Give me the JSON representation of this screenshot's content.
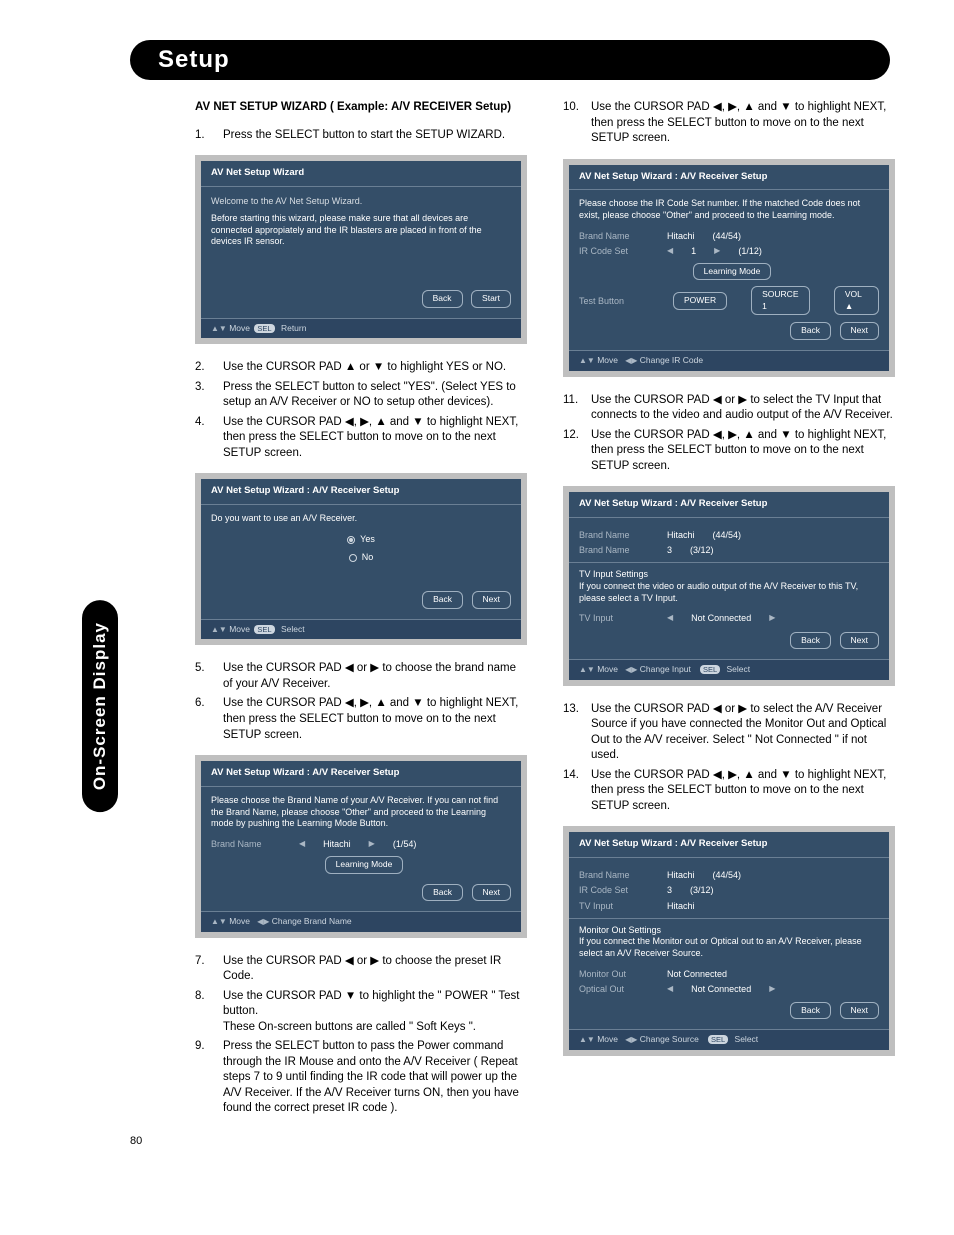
{
  "side_tab": "On-Screen Display",
  "header": {
    "title": "Setup"
  },
  "section_heading": "AV NET SETUP WIZARD ( Example: A/V RECEIVER Setup)",
  "page_number": "80",
  "left_steps": [
    {
      "n": "1.",
      "t": "Press the SELECT button to start the SETUP WIZARD."
    },
    {
      "n": "2.",
      "t": "Use the CURSOR PAD ▲ or ▼ to highlight YES or NO."
    },
    {
      "n": "3.",
      "t": "Press the SELECT button to select \"YES\". (Select YES to setup an A/V Receiver or NO to setup other devices)."
    },
    {
      "n": "4.",
      "t": "Use the CURSOR PAD ◀, ▶, ▲ and ▼ to highlight NEXT, then press the SELECT button to move on to the next SETUP screen."
    },
    {
      "n": "5.",
      "t": "Use the CURSOR PAD ◀ or ▶ to choose the brand name of your A/V Receiver."
    },
    {
      "n": "6.",
      "t": "Use the CURSOR PAD ◀, ▶, ▲ and ▼ to highlight NEXT, then press the SELECT button to move on to the next SETUP screen."
    },
    {
      "n": "7.",
      "t": "Use the CURSOR PAD ◀ or ▶ to choose the preset IR Code."
    },
    {
      "n": "8.",
      "t": "Use the CURSOR PAD ▼ to highlight the \" POWER \" Test button.\nThese On-screen buttons are called \" Soft Keys \"."
    },
    {
      "n": "9.",
      "t": "Press the SELECT button to pass the Power command through the IR Mouse and onto the A/V Receiver ( Repeat steps 7 to 9 until finding the IR code that will power up the A/V Receiver. If the A/V Receiver turns ON, then you have found the correct preset IR code )."
    }
  ],
  "right_steps": [
    {
      "n": "10.",
      "t": "Use the CURSOR PAD ◀, ▶, ▲ and ▼ to highlight NEXT, then press the SELECT button to move on to the next SETUP screen."
    },
    {
      "n": "11.",
      "t": "Use the CURSOR PAD ◀ or ▶ to select the TV Input that connects   to the video and audio output of the A/V Receiver."
    },
    {
      "n": "12.",
      "t": "Use the CURSOR PAD ◀, ▶, ▲ and ▼ to highlight NEXT, then press the SELECT button to move on to the next SETUP screen."
    },
    {
      "n": "13.",
      "t": "Use the CURSOR PAD ◀ or ▶ to select the A/V Receiver Source if you have connected the Monitor Out and Optical Out to the A/V receiver. Select \" Not Connected \" if not used."
    },
    {
      "n": "14.",
      "t": "Use the CURSOR PAD ◀, ▶, ▲ and ▼ to highlight NEXT, then press the SELECT button to move on to the next SETUP screen."
    }
  ],
  "panel1": {
    "title": "AV Net Setup Wizard",
    "sub": "Welcome to the AV Net Setup Wizard.",
    "msg": "Before starting this wizard, please make sure that all devices are connected appropiately and the IR blasters are placed in front of the devices IR sensor.",
    "back": "Back",
    "start": "Start",
    "footer_move": "Move",
    "footer_return": "Return"
  },
  "panel2": {
    "title": "AV Net Setup Wizard : A/V Receiver Setup",
    "q": "Do you want to use an A/V Receiver.",
    "yes": "Yes",
    "no": "No",
    "back": "Back",
    "next": "Next",
    "footer_move": "Move",
    "footer_select": "Select"
  },
  "panel3": {
    "title": "AV Net Setup Wizard : A/V Receiver Setup",
    "msg": "Please choose the Brand Name of your A/V Receiver. If you can not find the Brand Name, please choose \"Other\" and proceed to the Learning mode by pushing the Learning Mode Button.",
    "brand_lbl": "Brand Name",
    "brand_val": "Hitachi",
    "brand_idx": "(1/54)",
    "learn": "Learning Mode",
    "back": "Back",
    "next": "Next",
    "footer_move": "Move",
    "footer_change": "Change Brand Name"
  },
  "panel4": {
    "title": "AV Net Setup Wizard : A/V Receiver Setup",
    "msg": "Please choose the IR Code Set number. If the matched Code does not exist, please choose \"Other\" and proceed to the Learning mode.",
    "brand_lbl": "Brand Name",
    "brand_val": "Hitachi",
    "brand_idx": "(44/54)",
    "ir_lbl": "IR Code Set",
    "ir_val": "1",
    "ir_idx": "(1/12)",
    "learn": "Learning Mode",
    "test_lbl": "Test Button",
    "p": "POWER",
    "s": "SOURCE 1",
    "v": "VOL ▲",
    "back": "Back",
    "next": "Next",
    "footer_move": "Move",
    "footer_change": "Change IR Code"
  },
  "panel5": {
    "title": "AV Net Setup Wizard : A/V Receiver Setup",
    "brand_lbl": "Brand Name",
    "brand_val": "Hitachi",
    "brand_idx": "(44/54)",
    "brand2_lbl": "Brand Name",
    "brand2_val": "3",
    "brand2_idx": "(3/12)",
    "msg": "TV Input Settings\nIf you connect the video or audio output of the A/V Receiver to this TV, please select a TV Input.",
    "tv_lbl": "TV Input",
    "tv_val": "Not Connected",
    "back": "Back",
    "next": "Next",
    "footer_move": "Move",
    "footer_change": "Change Input",
    "footer_select": "Select"
  },
  "panel6": {
    "title": "AV Net Setup Wizard : A/V Receiver Setup",
    "brand_lbl": "Brand Name",
    "brand_val": "Hitachi",
    "brand_idx": "(44/54)",
    "ir_lbl": "IR Code Set",
    "ir_val": "3",
    "ir_idx": "(3/12)",
    "tvin_lbl": "TV Input",
    "tvin_val": "Hitachi",
    "msg": "Monitor Out Settings\nIf you connect the Monitor out or Optical out to an A/V Receiver, please select an A/V Receiver Source.",
    "mon_lbl": "Monitor Out",
    "mon_val": "Not Connected",
    "opt_lbl": "Optical Out",
    "opt_val": "Not Connected",
    "back": "Back",
    "next": "Next",
    "footer_move": "Move",
    "footer_change": "Change Source",
    "footer_select": "Select"
  }
}
